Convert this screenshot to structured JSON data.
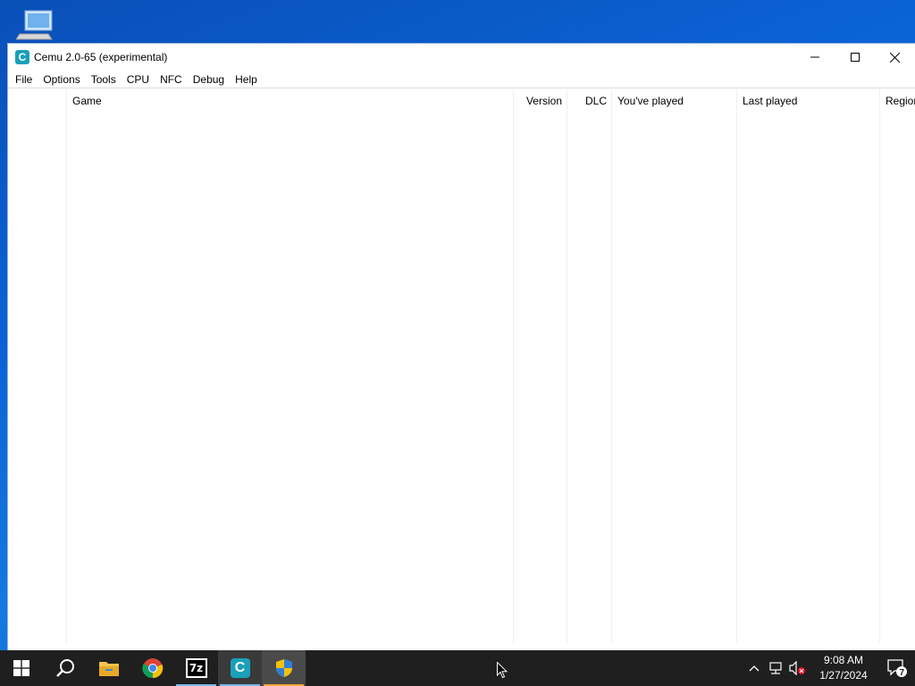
{
  "window": {
    "title": "Cemu 2.0-65 (experimental)",
    "app_icon_letter": "C",
    "controls": [
      "minimize-icon",
      "maximize-icon",
      "close-icon"
    ]
  },
  "menubar": {
    "items": [
      {
        "label": "File"
      },
      {
        "label": "Options"
      },
      {
        "label": "Tools"
      },
      {
        "label": "CPU"
      },
      {
        "label": "NFC"
      },
      {
        "label": "Debug"
      },
      {
        "label": "Help"
      }
    ]
  },
  "game_list": {
    "columns": [
      {
        "label": ""
      },
      {
        "label": "Game"
      },
      {
        "label": "Version"
      },
      {
        "label": "DLC"
      },
      {
        "label": "You've played"
      },
      {
        "label": "Last played"
      },
      {
        "label": "Region"
      }
    ],
    "rows": []
  },
  "taskbar": {
    "apps": [
      {
        "name": "start-icon"
      },
      {
        "name": "search-icon"
      },
      {
        "name": "file-explorer-icon"
      },
      {
        "name": "chrome-icon"
      },
      {
        "name": "7zip-icon",
        "label": "7z"
      },
      {
        "name": "cemu-icon",
        "label": "C"
      },
      {
        "name": "uac-shield-icon"
      }
    ],
    "tray": {
      "time": "9:08 AM",
      "date": "1/27/2024",
      "notification_count": "7"
    }
  },
  "colors": {
    "accent": "#76b9ed",
    "taskbar": "#1f1f1f",
    "cemu_icon": "#1aa0b8"
  }
}
